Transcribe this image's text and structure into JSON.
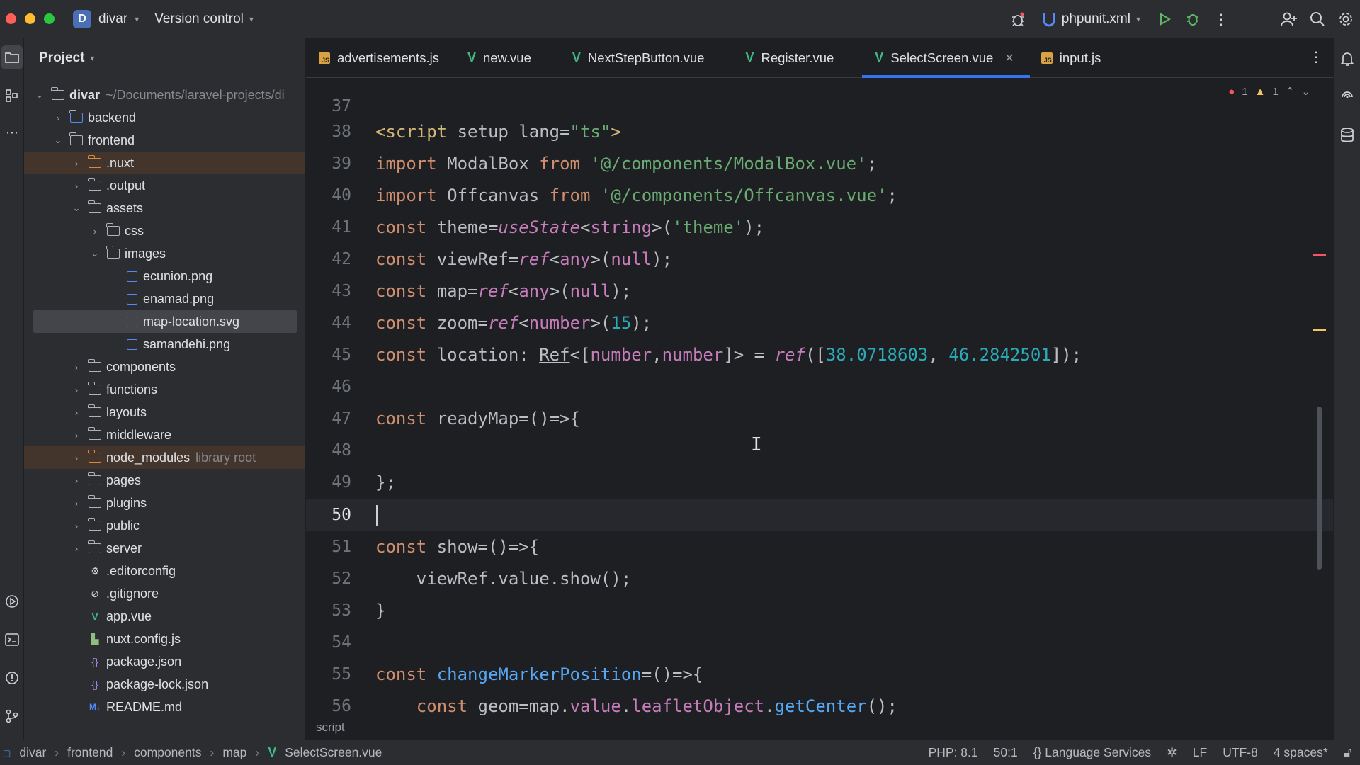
{
  "titlebar": {
    "project_badge": "D",
    "project_name": "divar",
    "vcs": "Version control",
    "run_config": "phpunit.xml"
  },
  "project_panel": {
    "title": "Project",
    "tree": [
      {
        "label": "divar",
        "suffix": "~/Documents/laravel-projects/di"
      },
      {
        "label": "backend"
      },
      {
        "label": "frontend"
      },
      {
        "label": ".nuxt"
      },
      {
        "label": ".output"
      },
      {
        "label": "assets"
      },
      {
        "label": "css"
      },
      {
        "label": "images"
      },
      {
        "label": "ecunion.png"
      },
      {
        "label": "enamad.png"
      },
      {
        "label": "map-location.svg"
      },
      {
        "label": "samandehi.png"
      },
      {
        "label": "components"
      },
      {
        "label": "functions"
      },
      {
        "label": "layouts"
      },
      {
        "label": "middleware"
      },
      {
        "label": "node_modules",
        "suffix": "library root"
      },
      {
        "label": "pages"
      },
      {
        "label": "plugins"
      },
      {
        "label": "public"
      },
      {
        "label": "server"
      },
      {
        "label": ".editorconfig"
      },
      {
        "label": ".gitignore"
      },
      {
        "label": "app.vue"
      },
      {
        "label": "nuxt.config.js"
      },
      {
        "label": "package.json"
      },
      {
        "label": "package-lock.json"
      },
      {
        "label": "README.md"
      }
    ]
  },
  "tabs": [
    {
      "label": "advertisements.js",
      "type": "js"
    },
    {
      "label": "new.vue",
      "type": "vue"
    },
    {
      "label": "NextStepButton.vue",
      "type": "vue"
    },
    {
      "label": "Register.vue",
      "type": "vue"
    },
    {
      "label": "SelectScreen.vue",
      "type": "vue",
      "active": true
    },
    {
      "label": "input.js",
      "type": "js"
    }
  ],
  "inspections": {
    "errors": "1",
    "warnings": "1"
  },
  "gutter": [
    "37",
    "38",
    "39",
    "40",
    "41",
    "42",
    "43",
    "44",
    "45",
    "46",
    "47",
    "48",
    "49",
    "50",
    "51",
    "52",
    "53",
    "54",
    "55",
    "56"
  ],
  "code_lines": [
    "",
    "<script setup lang=\"ts\">",
    "import ModalBox from '@/components/ModalBox.vue';",
    "import Offcanvas from '@/components/Offcanvas.vue';",
    "const theme=useState<string>('theme');",
    "const viewRef=ref<any>(null);",
    "const map=ref<any>(null);",
    "const zoom=ref<number>(15);",
    "const location: Ref<[number,number]> = ref([38.0718603, 46.2842501]);",
    "",
    "const readyMap=()=>{",
    "",
    "};",
    "",
    "const show=()=>{",
    "    viewRef.value.show();",
    "}",
    "",
    "const changeMarkerPosition=()=>{",
    "    const geom=map.value.leafletObject.getCenter();"
  ],
  "editor_breadcrumb": "script",
  "status": {
    "path": [
      "divar",
      "frontend",
      "components",
      "map",
      "SelectScreen.vue"
    ],
    "php": "PHP: 8.1",
    "position": "50:1",
    "lang_services": "Language Services",
    "line_sep": "LF",
    "encoding": "UTF-8",
    "indent": "4 spaces*"
  }
}
